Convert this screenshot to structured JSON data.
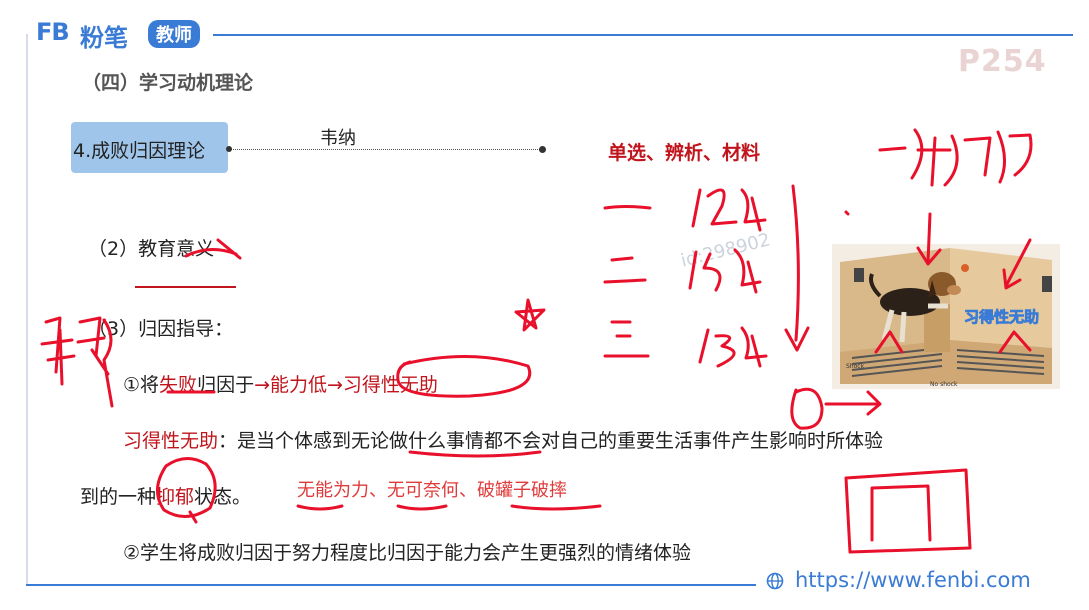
{
  "header": {
    "logo_fb": "FB",
    "logo_name": "粉笔",
    "logo_tag": "教师",
    "page_number": "P254"
  },
  "slide": {
    "section_title": "（四）学习动机理论",
    "theory_label": "4.成败归因理论",
    "author": "韦纳",
    "question_types": "单选、辨析、材料",
    "item2": "（2）教育意义",
    "item3": "（3）归因指导：",
    "point1_prefix": "①将",
    "point1_fail": "失败",
    "point1_mid": "归因于",
    "point1_arrow1": "→能力低→",
    "point1_result": "习得性无助",
    "def_term": "习得性无助",
    "def_text": "：是当个体感到无论做什么事情都不会对自己的重要生活事件产生影响时所体验",
    "def_text2_a": "到的一种",
    "def_text2_b": "抑郁",
    "def_text2_c": "状态。",
    "examples": "无能为力、无可奈何、破罐子破摔",
    "point2": "②学生将成败归因于努力程度比归因于能力会产生更强烈的情绪体验"
  },
  "image": {
    "caption": "习得性无助",
    "label_shock": "Shock",
    "label_noshock": "No shock"
  },
  "footer": {
    "url": "https://www.fenbi.com"
  },
  "watermark": "id:298902",
  "colors": {
    "brand": "#3a7bd5",
    "accent_red": "#c0151c",
    "ink": "#e8102a"
  }
}
